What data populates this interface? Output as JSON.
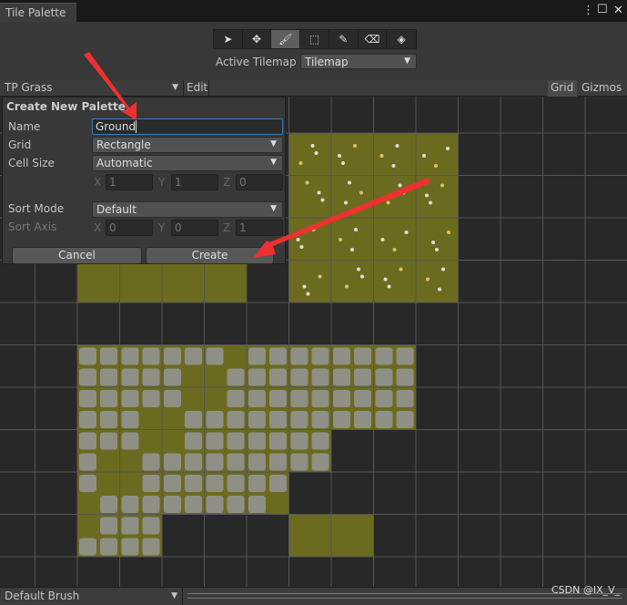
{
  "window": {
    "tab_title": "Tile Palette",
    "menu_icon": "kebab-icon",
    "maximize_icon": "maximize-icon",
    "close_icon": "close-icon"
  },
  "toolbar": {
    "tools": [
      {
        "name": "select-tool",
        "glyph": "➤"
      },
      {
        "name": "move-tool",
        "glyph": "✥"
      },
      {
        "name": "paint-brush-tool",
        "glyph": "🖌",
        "active": true
      },
      {
        "name": "box-fill-tool",
        "glyph": "⬚"
      },
      {
        "name": "picker-tool",
        "glyph": "✎"
      },
      {
        "name": "eraser-tool",
        "glyph": "⌫"
      },
      {
        "name": "fill-tool",
        "glyph": "◈"
      }
    ],
    "active_tilemap_label": "Active Tilemap",
    "active_tilemap_value": "Tilemap"
  },
  "palette_bar": {
    "palette": "TP Grass",
    "edit": "Edit",
    "grid": "Grid",
    "gizmos": "Gizmos"
  },
  "dialog": {
    "title": "Create New Palette",
    "name_label": "Name",
    "name_value": "Ground",
    "grid_label": "Grid",
    "grid_value": "Rectangle",
    "cell_size_label": "Cell Size",
    "cell_size_value": "Automatic",
    "cell": {
      "x": "1",
      "y": "1",
      "z": "0"
    },
    "sort_mode_label": "Sort Mode",
    "sort_mode_value": "Default",
    "sort_axis_label": "Sort Axis",
    "sort_axis": {
      "x": "0",
      "y": "0",
      "z": "1"
    },
    "axis_x": "X",
    "axis_y": "Y",
    "axis_z": "Z",
    "cancel": "Cancel",
    "create": "Create"
  },
  "bottom": {
    "brush": "Default Brush",
    "watermark": "CSDN @IX_V_"
  },
  "colors": {
    "grass": "#6b6b1f",
    "stone": "#8f8f86",
    "arrow": "#ee3030",
    "focus": "#3a79bb"
  }
}
